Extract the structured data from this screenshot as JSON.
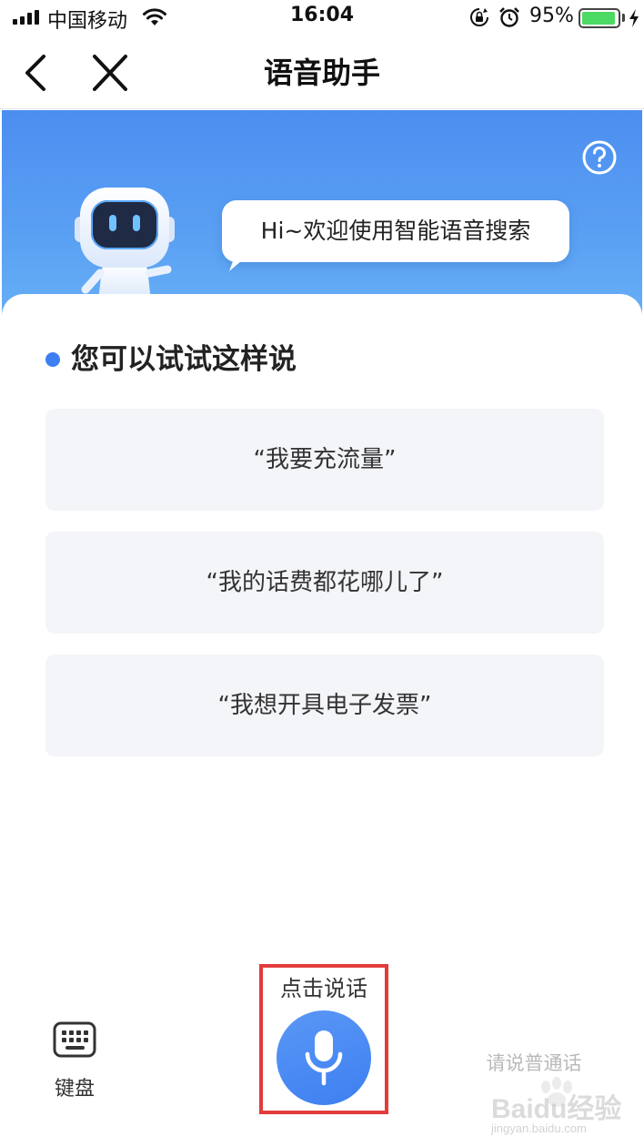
{
  "status_bar": {
    "carrier": "中国移动",
    "time": "16:04",
    "battery_percent": "95%",
    "battery_level": 0.95,
    "icons": [
      "signal-icon",
      "wifi-icon",
      "orientation-lock-icon",
      "alarm-icon",
      "battery-icon",
      "charging-icon"
    ]
  },
  "nav": {
    "title": "语音助手",
    "back_icon": "chevron-left-icon",
    "close_icon": "close-icon"
  },
  "hero": {
    "greeting": "Hi~欢迎使用智能语音搜索",
    "help_icon": "question-circle-icon",
    "colors": {
      "gradient_top": "#4c8ef0",
      "gradient_bottom": "#69b1f6"
    }
  },
  "suggestions": {
    "title": "您可以试试这样说",
    "items": [
      {
        "label": "“我要充流量”"
      },
      {
        "label": "“我的话费都花哪儿了”"
      },
      {
        "label": "“我想开具电子发票”"
      }
    ]
  },
  "controls": {
    "keyboard_label": "键盘",
    "speak_hint": "点击说话",
    "mandarin_hint": "请说普通话",
    "mic_icon": "microphone-icon",
    "accent_color": "#3d7ff2",
    "highlight_color": "#e33b3b"
  },
  "watermark": {
    "brand": "Baidu经验",
    "url": "jingyan.baidu.com"
  }
}
